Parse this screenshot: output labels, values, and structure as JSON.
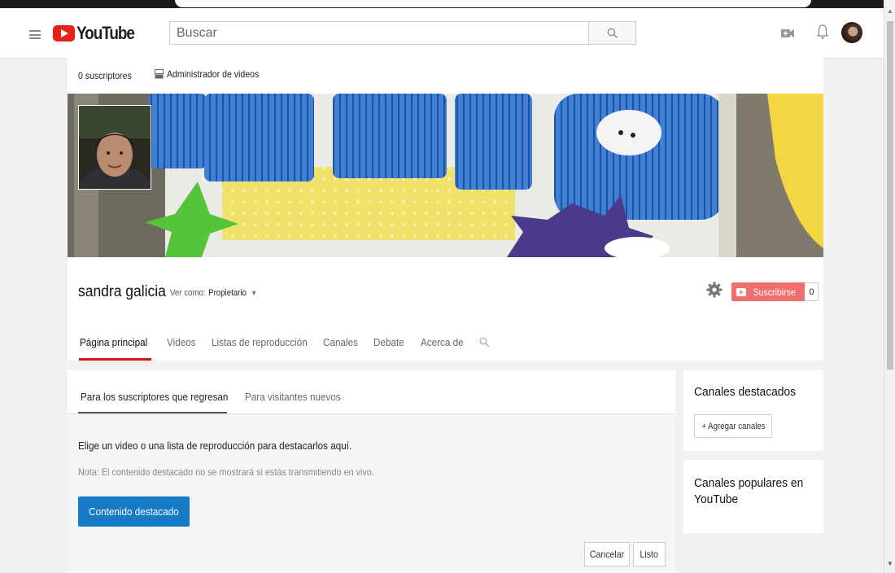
{
  "masthead": {
    "logo_text": "YouTube",
    "search_placeholder": "Buscar"
  },
  "channel": {
    "subscribers": "0 suscriptores",
    "video_manager": "Administrador de videos",
    "name": "sandra galicia",
    "view_as_label": "Ver como:",
    "view_as_value": "Propietario",
    "subscribe_label": "Suscribirse",
    "subscribe_count": "0",
    "tabs": [
      {
        "label": "Página principal",
        "active": true
      },
      {
        "label": "Videos"
      },
      {
        "label": "Listas de reproducción"
      },
      {
        "label": "Canales"
      },
      {
        "label": "Debate"
      },
      {
        "label": "Acerca de"
      }
    ]
  },
  "featured": {
    "tabs": [
      {
        "label": "Para los suscriptores que regresan",
        "active": true
      },
      {
        "label": "Para visitantes nuevos"
      }
    ],
    "message": "Elige un video o una lista de reproducción para destacarlos aquí.",
    "note": "Nota: El contenido destacado no se mostrará si estás transmitiendo en vivo.",
    "button": "Contenido destacado",
    "cancel": "Cancelar",
    "done": "Listo"
  },
  "sidebar": {
    "featured_channels_title": "Canales destacados",
    "add_channels": "+ Agregar canales",
    "popular_channels_title": "Canales populares en YouTube"
  },
  "colors": {
    "brand_red": "#e62117",
    "subscribe_bg": "#f06e6e",
    "primary_blue": "#167ac6",
    "active_tab": "#cc181e"
  }
}
